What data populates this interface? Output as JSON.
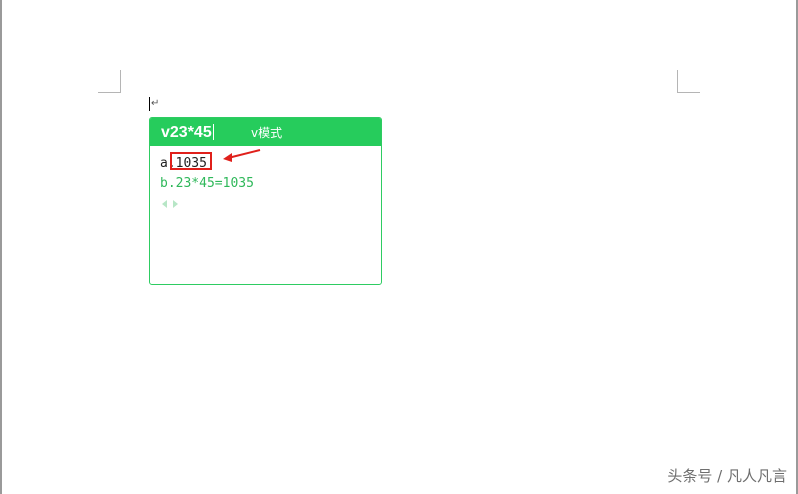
{
  "document": {
    "paragraph_mark": "↵"
  },
  "ime": {
    "input": "v23*45",
    "mode_label": "v模式",
    "candidates": [
      {
        "label": "a.",
        "value": "1035"
      },
      {
        "label": "b.",
        "value": "23*45=1035"
      }
    ],
    "pager_prev_icon": "triangle-left-icon",
    "pager_next_icon": "triangle-right-icon",
    "accent_color": "#26cc5c"
  },
  "annotation": {
    "highlight_color": "#e0201b"
  },
  "watermark": {
    "text": "头条号 / 凡人凡言"
  }
}
